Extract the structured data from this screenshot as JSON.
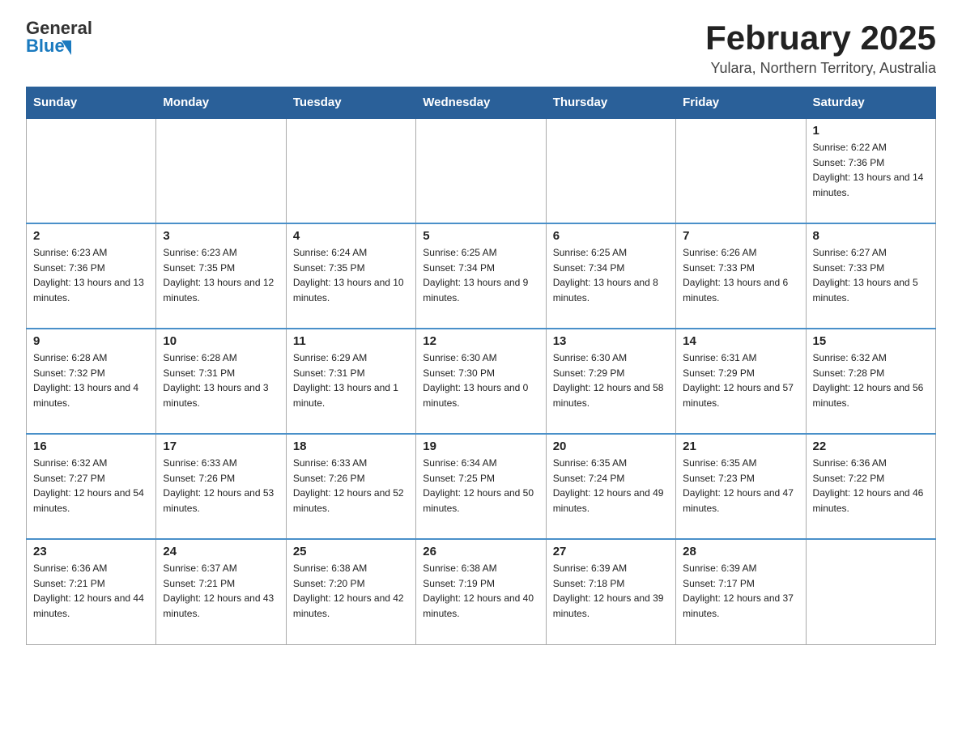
{
  "header": {
    "logo_general": "General",
    "logo_blue": "Blue",
    "title": "February 2025",
    "location": "Yulara, Northern Territory, Australia"
  },
  "days_of_week": [
    "Sunday",
    "Monday",
    "Tuesday",
    "Wednesday",
    "Thursday",
    "Friday",
    "Saturday"
  ],
  "weeks": [
    [
      {
        "day": "",
        "info": ""
      },
      {
        "day": "",
        "info": ""
      },
      {
        "day": "",
        "info": ""
      },
      {
        "day": "",
        "info": ""
      },
      {
        "day": "",
        "info": ""
      },
      {
        "day": "",
        "info": ""
      },
      {
        "day": "1",
        "info": "Sunrise: 6:22 AM\nSunset: 7:36 PM\nDaylight: 13 hours and 14 minutes."
      }
    ],
    [
      {
        "day": "2",
        "info": "Sunrise: 6:23 AM\nSunset: 7:36 PM\nDaylight: 13 hours and 13 minutes."
      },
      {
        "day": "3",
        "info": "Sunrise: 6:23 AM\nSunset: 7:35 PM\nDaylight: 13 hours and 12 minutes."
      },
      {
        "day": "4",
        "info": "Sunrise: 6:24 AM\nSunset: 7:35 PM\nDaylight: 13 hours and 10 minutes."
      },
      {
        "day": "5",
        "info": "Sunrise: 6:25 AM\nSunset: 7:34 PM\nDaylight: 13 hours and 9 minutes."
      },
      {
        "day": "6",
        "info": "Sunrise: 6:25 AM\nSunset: 7:34 PM\nDaylight: 13 hours and 8 minutes."
      },
      {
        "day": "7",
        "info": "Sunrise: 6:26 AM\nSunset: 7:33 PM\nDaylight: 13 hours and 6 minutes."
      },
      {
        "day": "8",
        "info": "Sunrise: 6:27 AM\nSunset: 7:33 PM\nDaylight: 13 hours and 5 minutes."
      }
    ],
    [
      {
        "day": "9",
        "info": "Sunrise: 6:28 AM\nSunset: 7:32 PM\nDaylight: 13 hours and 4 minutes."
      },
      {
        "day": "10",
        "info": "Sunrise: 6:28 AM\nSunset: 7:31 PM\nDaylight: 13 hours and 3 minutes."
      },
      {
        "day": "11",
        "info": "Sunrise: 6:29 AM\nSunset: 7:31 PM\nDaylight: 13 hours and 1 minute."
      },
      {
        "day": "12",
        "info": "Sunrise: 6:30 AM\nSunset: 7:30 PM\nDaylight: 13 hours and 0 minutes."
      },
      {
        "day": "13",
        "info": "Sunrise: 6:30 AM\nSunset: 7:29 PM\nDaylight: 12 hours and 58 minutes."
      },
      {
        "day": "14",
        "info": "Sunrise: 6:31 AM\nSunset: 7:29 PM\nDaylight: 12 hours and 57 minutes."
      },
      {
        "day": "15",
        "info": "Sunrise: 6:32 AM\nSunset: 7:28 PM\nDaylight: 12 hours and 56 minutes."
      }
    ],
    [
      {
        "day": "16",
        "info": "Sunrise: 6:32 AM\nSunset: 7:27 PM\nDaylight: 12 hours and 54 minutes."
      },
      {
        "day": "17",
        "info": "Sunrise: 6:33 AM\nSunset: 7:26 PM\nDaylight: 12 hours and 53 minutes."
      },
      {
        "day": "18",
        "info": "Sunrise: 6:33 AM\nSunset: 7:26 PM\nDaylight: 12 hours and 52 minutes."
      },
      {
        "day": "19",
        "info": "Sunrise: 6:34 AM\nSunset: 7:25 PM\nDaylight: 12 hours and 50 minutes."
      },
      {
        "day": "20",
        "info": "Sunrise: 6:35 AM\nSunset: 7:24 PM\nDaylight: 12 hours and 49 minutes."
      },
      {
        "day": "21",
        "info": "Sunrise: 6:35 AM\nSunset: 7:23 PM\nDaylight: 12 hours and 47 minutes."
      },
      {
        "day": "22",
        "info": "Sunrise: 6:36 AM\nSunset: 7:22 PM\nDaylight: 12 hours and 46 minutes."
      }
    ],
    [
      {
        "day": "23",
        "info": "Sunrise: 6:36 AM\nSunset: 7:21 PM\nDaylight: 12 hours and 44 minutes."
      },
      {
        "day": "24",
        "info": "Sunrise: 6:37 AM\nSunset: 7:21 PM\nDaylight: 12 hours and 43 minutes."
      },
      {
        "day": "25",
        "info": "Sunrise: 6:38 AM\nSunset: 7:20 PM\nDaylight: 12 hours and 42 minutes."
      },
      {
        "day": "26",
        "info": "Sunrise: 6:38 AM\nSunset: 7:19 PM\nDaylight: 12 hours and 40 minutes."
      },
      {
        "day": "27",
        "info": "Sunrise: 6:39 AM\nSunset: 7:18 PM\nDaylight: 12 hours and 39 minutes."
      },
      {
        "day": "28",
        "info": "Sunrise: 6:39 AM\nSunset: 7:17 PM\nDaylight: 12 hours and 37 minutes."
      },
      {
        "day": "",
        "info": ""
      }
    ]
  ]
}
